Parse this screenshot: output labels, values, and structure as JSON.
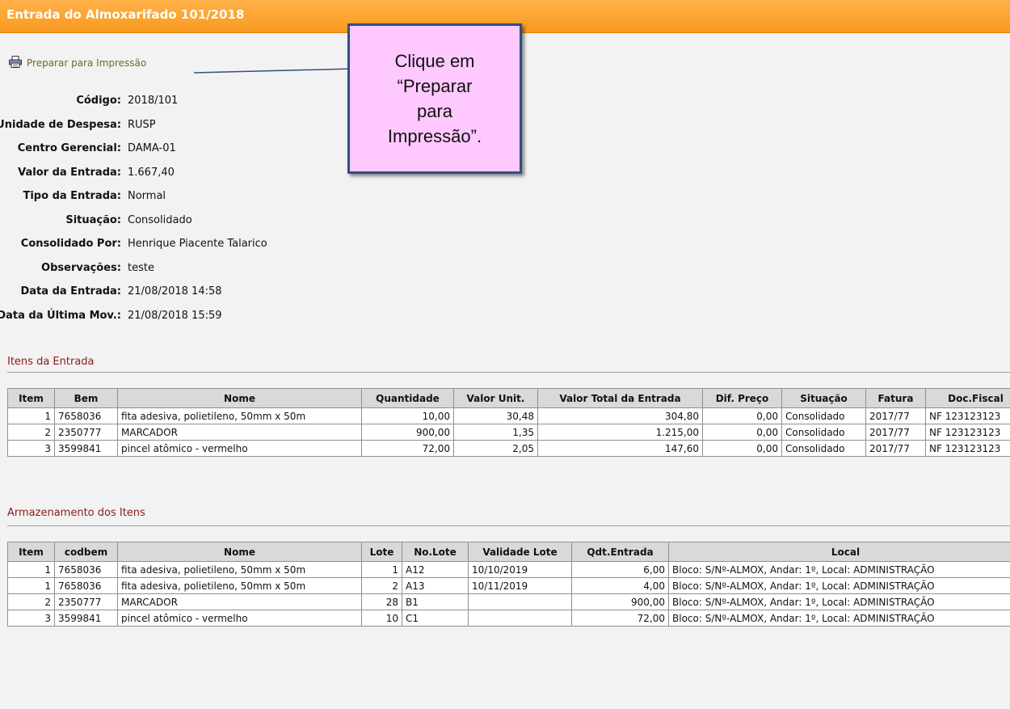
{
  "title": "Entrada do Almoxarifado 101/2018",
  "print_link": {
    "label": "Preparar para Impressão",
    "icon": "printer-icon"
  },
  "callout": {
    "line1": "Clique em",
    "line2": "“Preparar",
    "line3": "para",
    "line4": "Impressão”."
  },
  "fields": [
    {
      "label": "Código:",
      "value": "2018/101"
    },
    {
      "label": "Unidade de Despesa:",
      "value": "RUSP"
    },
    {
      "label": "Centro Gerencial:",
      "value": "DAMA-01"
    },
    {
      "label": "Valor da Entrada:",
      "value": "1.667,40"
    },
    {
      "label": "Tipo da Entrada:",
      "value": "Normal"
    },
    {
      "label": "Situação:",
      "value": "Consolidado"
    },
    {
      "label": "Consolidado Por:",
      "value": "Henrique Piacente Talarico"
    },
    {
      "label": "Observações:",
      "value": "teste"
    },
    {
      "label": "Data da Entrada:",
      "value": "21/08/2018 14:58"
    },
    {
      "label": "Data da Última Mov.:",
      "value": "21/08/2018 15:59"
    }
  ],
  "itens": {
    "title": "Itens da Entrada",
    "headers": [
      "Item",
      "Bem",
      "Nome",
      "Quantidade",
      "Valor Unit.",
      "Valor Total da Entrada",
      "Dif. Preço",
      "Situação",
      "Fatura",
      "Doc.Fiscal"
    ],
    "rows": [
      [
        "1",
        "7658036",
        "fita adesiva, polietileno, 50mm x 50m",
        "10,00",
        "30,48",
        "304,80",
        "0,00",
        "Consolidado",
        "2017/77",
        "NF 123123123"
      ],
      [
        "2",
        "2350777",
        "MARCADOR",
        "900,00",
        "1,35",
        "1.215,00",
        "0,00",
        "Consolidado",
        "2017/77",
        "NF 123123123"
      ],
      [
        "3",
        "3599841",
        "pincel atômico - vermelho",
        "72,00",
        "2,05",
        "147,60",
        "0,00",
        "Consolidado",
        "2017/77",
        "NF 123123123"
      ]
    ]
  },
  "armazenamento": {
    "title": "Armazenamento dos Itens",
    "headers": [
      "Item",
      "codbem",
      "Nome",
      "Lote",
      "No.Lote",
      "Validade Lote",
      "Qdt.Entrada",
      "Local"
    ],
    "rows": [
      [
        "1",
        "7658036",
        "fita adesiva, polietileno, 50mm x 50m",
        "1",
        "A12",
        "10/10/2019",
        "6,00",
        "Bloco: S/Nº-ALMOX, Andar: 1º, Local: ADMINISTRAÇÃO"
      ],
      [
        "1",
        "7658036",
        "fita adesiva, polietileno, 50mm x 50m",
        "2",
        "A13",
        "10/11/2019",
        "4,00",
        "Bloco: S/Nº-ALMOX, Andar: 1º, Local: ADMINISTRAÇÃO"
      ],
      [
        "2",
        "2350777",
        "MARCADOR",
        "28",
        "B1",
        "",
        "900,00",
        "Bloco: S/Nº-ALMOX, Andar: 1º, Local: ADMINISTRAÇÃO"
      ],
      [
        "3",
        "3599841",
        "pincel atômico - vermelho",
        "10",
        "C1",
        "",
        "72,00",
        "Bloco: S/Nº-ALMOX, Andar: 1º, Local: ADMINISTRAÇÃO"
      ]
    ]
  },
  "colors": {
    "title_bar": "#f79a1e",
    "callout_fill": "#ffc8ff",
    "callout_border": "#2f4f88",
    "section_title": "#8b1a1a",
    "link": "#6b6b2b"
  }
}
